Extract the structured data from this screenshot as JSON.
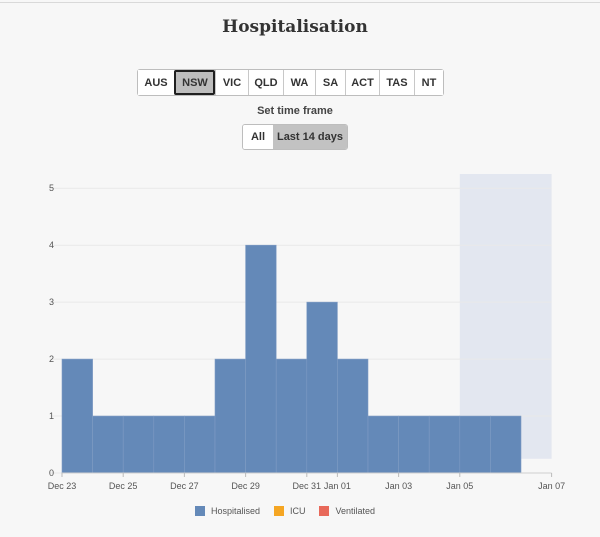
{
  "page": {
    "title": "Hospitalisation"
  },
  "regions": {
    "items": [
      "AUS",
      "NSW",
      "VIC",
      "QLD",
      "WA",
      "SA",
      "ACT",
      "TAS",
      "NT"
    ],
    "selected": "NSW"
  },
  "timeframe": {
    "label": "Set time frame",
    "options": [
      "All",
      "Last 14 days"
    ],
    "selected": "Last 14 days"
  },
  "legend": [
    {
      "name": "Hospitalised",
      "color": "#6489b8"
    },
    {
      "name": "ICU",
      "color": "#f5a623"
    },
    {
      "name": "Ventilated",
      "color": "#e8695a"
    }
  ],
  "chart_data": {
    "type": "bar",
    "title": "Hospitalisation",
    "x_tick_labels": [
      "Dec 23",
      "Dec 25",
      "Dec 27",
      "Dec 29",
      "Dec 31",
      "Jan 01",
      "Jan 03",
      "Jan 05",
      "Jan 07"
    ],
    "y_ticks": [
      0,
      1,
      2,
      3,
      4,
      5
    ],
    "ylim": [
      0,
      5.25
    ],
    "series": [
      {
        "name": "Hospitalised",
        "color": "#6489b8",
        "categories": [
          "Dec 23",
          "Dec 24",
          "Dec 25",
          "Dec 26",
          "Dec 27",
          "Dec 28",
          "Dec 29",
          "Dec 30",
          "Dec 31",
          "Jan 01",
          "Jan 02",
          "Jan 03",
          "Jan 04",
          "Jan 05",
          "Jan 06"
        ],
        "values": [
          2,
          1,
          1,
          1,
          1,
          2,
          4,
          2,
          3,
          2,
          1,
          1,
          1,
          1,
          1
        ]
      }
    ],
    "shaded_region_start": "Jan 05",
    "shaded_color": "#e3e7f0",
    "grid": true,
    "legend_position": "bottom"
  }
}
